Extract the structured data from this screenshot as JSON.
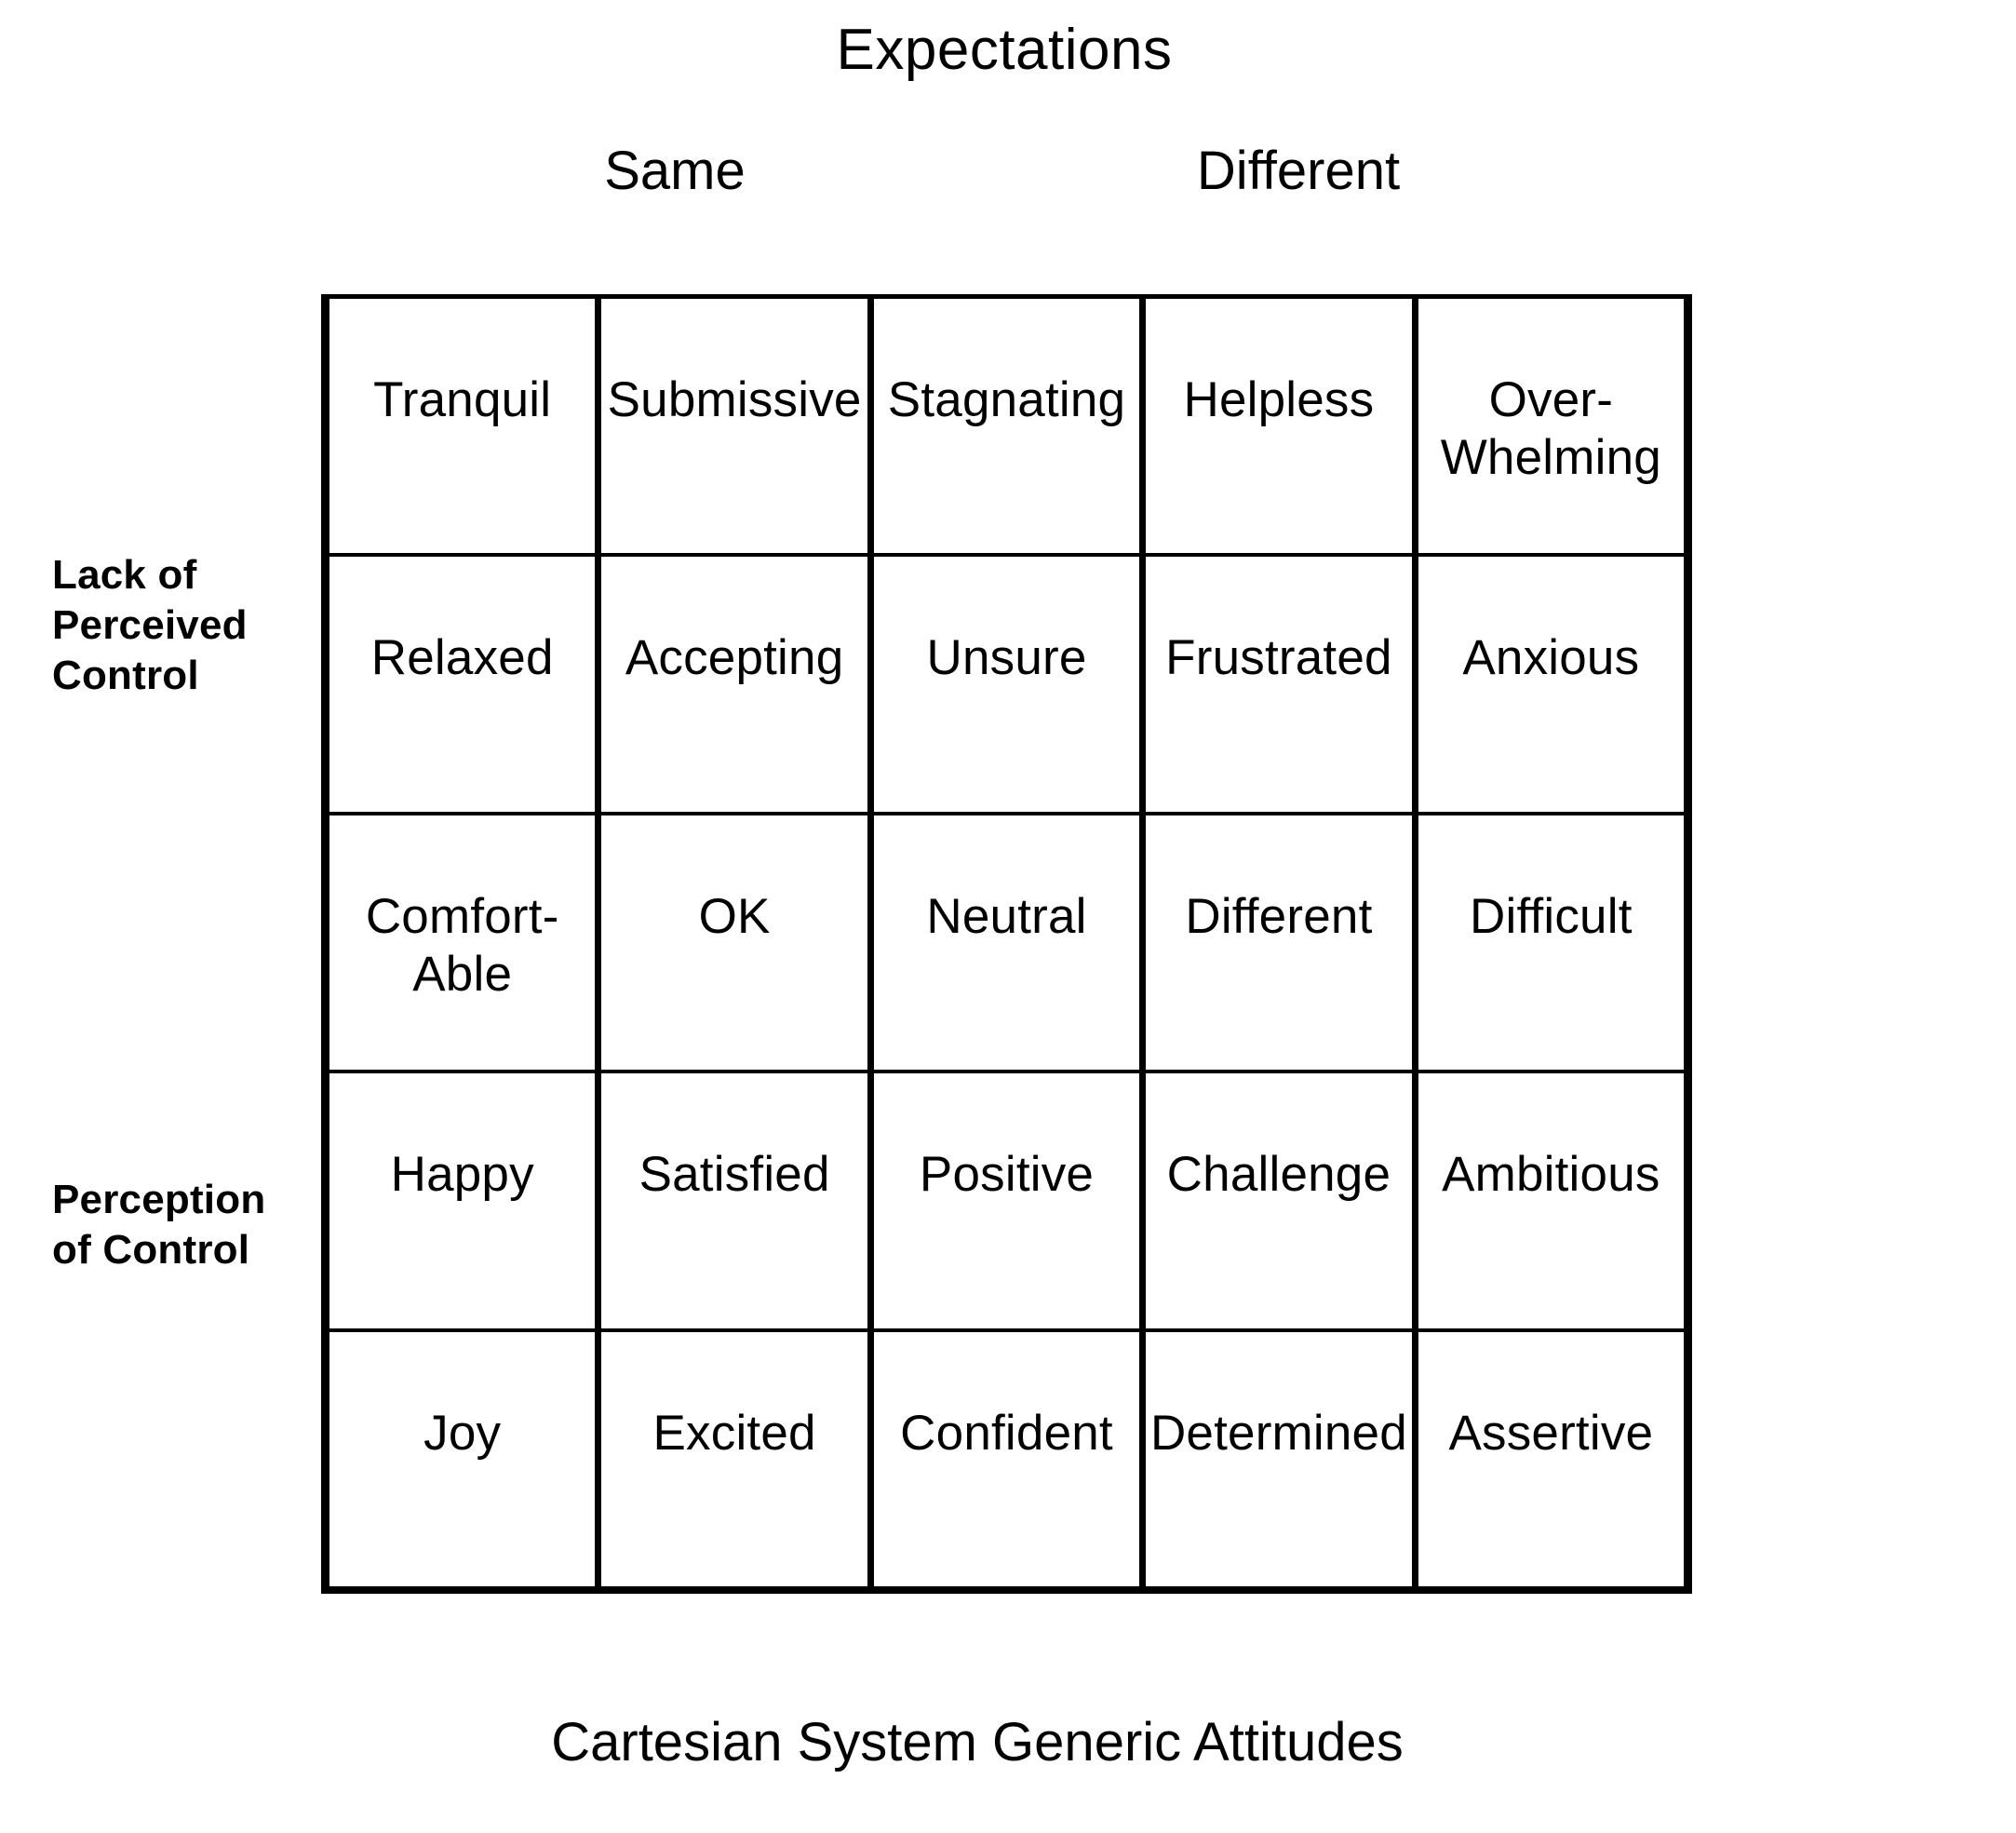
{
  "figure": {
    "caption": "Cartesian System Generic Attitudes",
    "x_axis_title": "Expectations",
    "column_groups": [
      {
        "label": "Same"
      },
      {
        "label": "Different"
      }
    ],
    "row_groups": [
      {
        "label": "Lack of\nPerceived\nControl"
      },
      {
        "label": "Perception\nof Control"
      }
    ]
  },
  "chart_data": {
    "type": "table",
    "title": "Cartesian System Generic Attitudes",
    "xlabel": "Expectations",
    "ylabel": "",
    "axis_headers": {
      "x": [
        "Same",
        "Different"
      ],
      "y": [
        "Lack of Perceived Control",
        "Perception of Control"
      ]
    },
    "grid": {
      "columns": 5,
      "rows": 5
    },
    "rows": [
      {
        "cells": [
          "Tranquil",
          "Submissive",
          "Stagnating",
          "Helpless",
          "Over-\nWhelming"
        ]
      },
      {
        "cells": [
          "Relaxed",
          "Accepting",
          "Unsure",
          "Frustrated",
          "Anxious"
        ]
      },
      {
        "cells": [
          "Comfort-\nAble",
          "OK",
          "Neutral",
          "Different",
          "Difficult"
        ]
      },
      {
        "cells": [
          "Happy",
          "Satisfied",
          "Positive",
          "Challenge",
          "Ambitious"
        ]
      },
      {
        "cells": [
          "Joy",
          "Excited",
          "Confident",
          "Determined",
          "Assertive"
        ]
      }
    ],
    "colors": {
      "background": "#ffffff",
      "ink": "#000000"
    }
  }
}
